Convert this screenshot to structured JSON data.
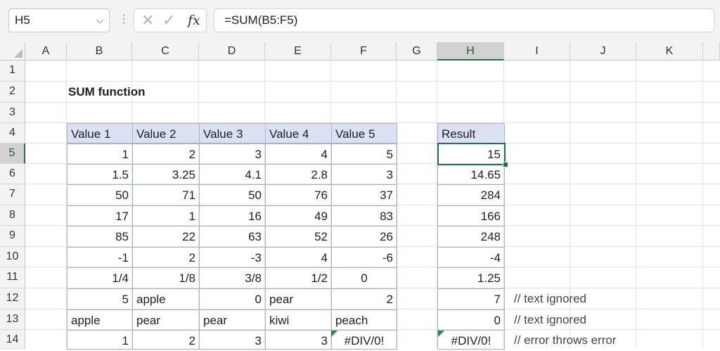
{
  "formula_bar": {
    "name_box": "H5",
    "chevron_icon": "chevron-down-icon",
    "more_icon": "vertical-dots-icon",
    "cancel_icon": "cross-icon",
    "enter_icon": "check-icon",
    "fx_label": "fx",
    "formula": "=SUM(B5:F5)"
  },
  "columns": [
    "A",
    "B",
    "C",
    "D",
    "E",
    "F",
    "G",
    "H",
    "I",
    "J",
    "K"
  ],
  "rows": [
    "1",
    "2",
    "3",
    "4",
    "5",
    "6",
    "7",
    "8",
    "9",
    "10",
    "11",
    "12",
    "13",
    "14"
  ],
  "selected": {
    "column": "H",
    "row": "5"
  },
  "sheet": {
    "title": "SUM function",
    "table_headers": [
      "Value 1",
      "Value 2",
      "Value 3",
      "Value 4",
      "Value 5"
    ],
    "table_rows": [
      [
        "1",
        "2",
        "3",
        "4",
        "5"
      ],
      [
        "1.5",
        "3.25",
        "4.1",
        "2.8",
        "3"
      ],
      [
        "50",
        "71",
        "50",
        "76",
        "37"
      ],
      [
        "17",
        "1",
        "16",
        "49",
        "83"
      ],
      [
        "85",
        "22",
        "63",
        "52",
        "26"
      ],
      [
        "-1",
        "2",
        "-3",
        "4",
        "-6"
      ],
      [
        "1/4",
        "1/8",
        "3/8",
        "1/2",
        "0"
      ],
      [
        "5",
        "apple",
        "0",
        "pear",
        "2"
      ],
      [
        "apple",
        "pear",
        "pear",
        "kiwi",
        "peach"
      ],
      [
        "1",
        "2",
        "3",
        "3",
        "#DIV/0!"
      ]
    ],
    "result_header": "Result",
    "results": [
      "15",
      "14.65",
      "284",
      "166",
      "248",
      "-4",
      "1.25",
      "7",
      "0",
      "#DIV/0!"
    ],
    "comments": {
      "row12": "// text ignored",
      "row13": "// text ignored",
      "row14": "// error throws error"
    }
  },
  "colors": {
    "header_fill": "#d9e1f2",
    "selection": "#217346",
    "error_indicator": "#2c8a3e"
  }
}
